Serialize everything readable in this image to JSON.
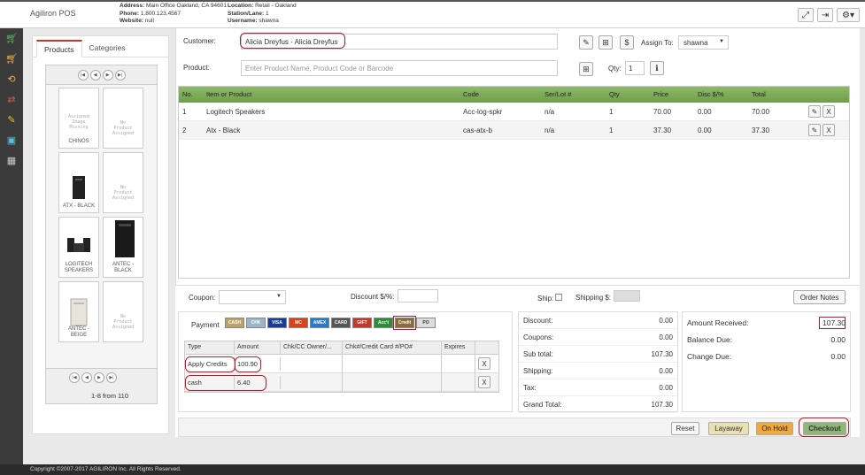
{
  "app": {
    "brand": "Agiliron POS",
    "info_col1": [
      {
        "k": "Address:",
        "v": "Main Office Oakland, CA 94601"
      },
      {
        "k": "Phone:",
        "v": "1.800.123.4567"
      },
      {
        "k": "Website:",
        "v": "null"
      }
    ],
    "info_col2": [
      {
        "k": "Location:",
        "v": "Retail - Oakland"
      },
      {
        "k": "Station/Lane:",
        "v": "1"
      },
      {
        "k": "Username:",
        "v": "shawna"
      }
    ],
    "top_icons": [
      "fullscreen-icon",
      "logout-icon",
      "settings-gear-icon"
    ],
    "footer": "Copyright ©2007-2017 AGILIRON Inc. All Rights Reserved."
  },
  "rail": {
    "items": [
      {
        "icon": "cart-icon",
        "color": "#5cb85c"
      },
      {
        "icon": "cart-full-icon",
        "color": "#f0ad4e"
      },
      {
        "icon": "cart-return-icon",
        "color": "#f0ad4e"
      },
      {
        "icon": "swap-arrows-icon",
        "color": "#d9534f"
      },
      {
        "icon": "edit-icon",
        "color": "#f0c419"
      },
      {
        "icon": "cash-icon",
        "color": "#5bc0de"
      },
      {
        "icon": "grid-table-icon",
        "color": "#cccccc"
      }
    ]
  },
  "left": {
    "tabs": [
      "Products",
      "Categories"
    ],
    "tiles": [
      {
        "noimg": "Assigned\nImage\nMissing",
        "name": "CHINOS",
        "pic": ""
      },
      {
        "noimg": "No\nProduct\nAssigned",
        "name": "",
        "pic": ""
      },
      {
        "noimg": "",
        "name": "ATX - BLACK",
        "pic": "tower"
      },
      {
        "noimg": "No\nProduct\nAssigned",
        "name": "",
        "pic": ""
      },
      {
        "noimg": "",
        "name": "LOGITECH\nSPEAKERS",
        "pic": "speakers"
      },
      {
        "noimg": "",
        "name": "ANTEC -\nBLACK",
        "pic": "tower-big"
      },
      {
        "noimg": "",
        "name": "ANTEC -\nBEIGE",
        "pic": "tower-beige"
      },
      {
        "noimg": "No\nProduct\nAssigned",
        "name": "",
        "pic": ""
      }
    ],
    "count": "1-8 from 110"
  },
  "form": {
    "customer_label": "Customer:",
    "customer_value": "Alicia Dreyfus - Alicia Dreyfus",
    "assign_label": "Assign To:",
    "assign_value": "shawna",
    "product_label": "Product:",
    "product_placeholder": "Enter Product Name, Product Code or Barcode",
    "qty_label": "Qty:",
    "qty_value": "1"
  },
  "grid": {
    "headers": [
      "No.",
      "Item or Product",
      "Code",
      "Ser/Lot #",
      "Qty",
      "Price",
      "Disc $/%",
      "Total"
    ],
    "rows": [
      [
        "1",
        "Logitech Speakers",
        "Acc-log-spkr",
        "n/a",
        "1",
        "70.00",
        "0.00",
        "70.00"
      ],
      [
        "2",
        "Atx - Black",
        "cas-atx-b",
        "n/a",
        "1",
        "37.30",
        "0.00",
        "37.30"
      ]
    ],
    "accent": "#7aa955"
  },
  "lower": {
    "coupon_label": "Coupon:",
    "discount_label": "Discount $/%:",
    "ship_label": "Ship:",
    "shipping_label": "Shipping $:",
    "order_notes": "Order Notes",
    "payment_label": "Payment",
    "pay_methods": [
      "CASH",
      "CHK",
      "VISA",
      "MC",
      "AMEX",
      "CARD",
      "GIFT",
      "Acc't",
      "Credit",
      "PO"
    ],
    "pay_headers": [
      "Type",
      "Amount",
      "Chk/CC Owner/...",
      "Chk#/Credit Card #/PO#",
      "Expires"
    ],
    "payments": [
      {
        "type": "Apply Credits",
        "amount": "100.90"
      },
      {
        "type": "cash",
        "amount": "6.40"
      }
    ],
    "remove_label": "X"
  },
  "totals": [
    {
      "label": "Discount:",
      "value": "0.00"
    },
    {
      "label": "Coupons:",
      "value": "0.00"
    },
    {
      "label": "Sub total:",
      "value": "107.30"
    },
    {
      "label": "Shipping:",
      "value": "0.00"
    },
    {
      "label": "Tax:",
      "value": "0.00"
    },
    {
      "label": "Grand Total:",
      "value": "107.30"
    }
  ],
  "received": {
    "amount_label": "Amount Received:",
    "amount_value": "107.30",
    "balance_label": "Balance Due:",
    "balance_value": "0.00",
    "change_label": "Change Due:",
    "change_value": "0.00"
  },
  "actions": {
    "reset": "Reset",
    "layaway": "Layaway",
    "onhold": "On Hold",
    "checkout": "Checkout"
  }
}
